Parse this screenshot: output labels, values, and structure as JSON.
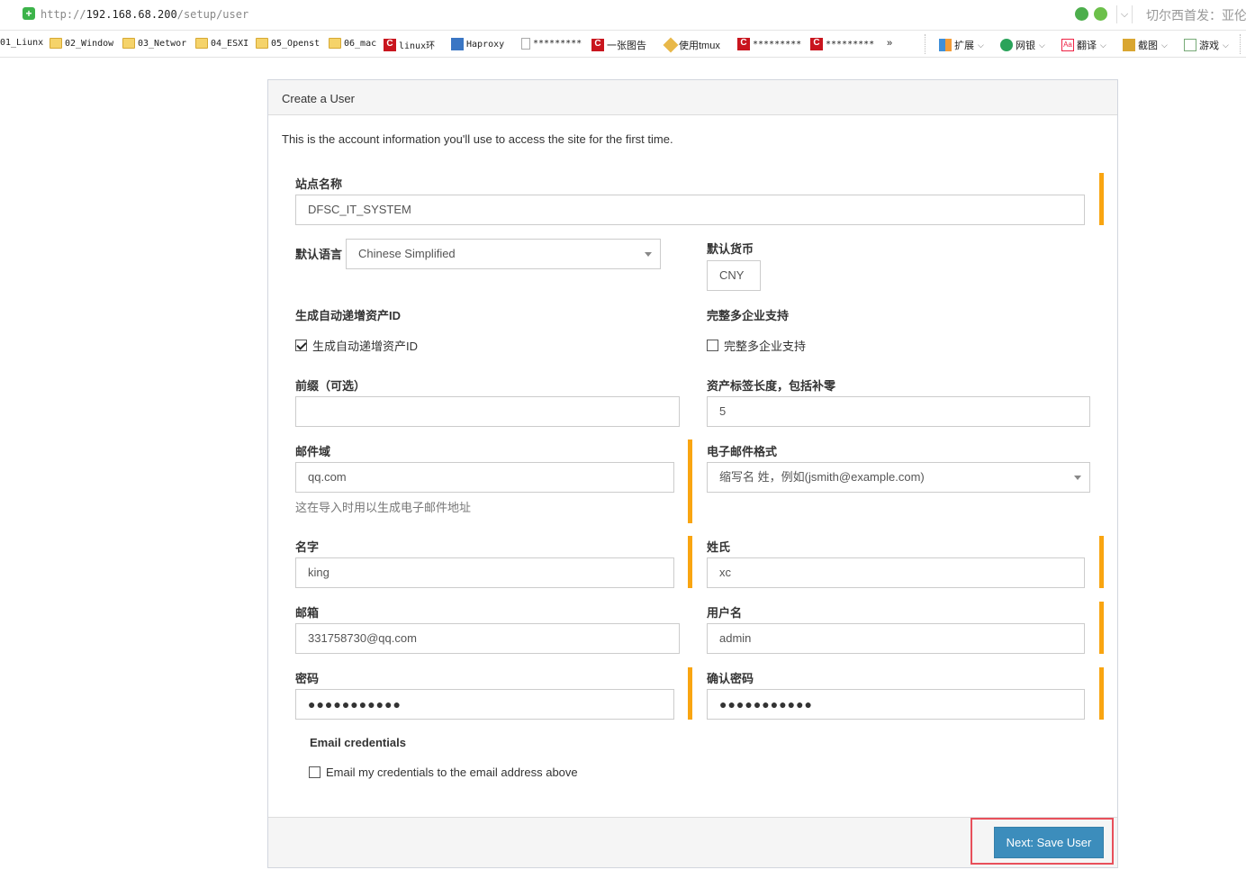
{
  "browser": {
    "url_scheme": "http://",
    "url_host": "192.168.68.200",
    "url_path": "/setup/user",
    "news_text": "切尔西首发：亚伦",
    "bookmarks": [
      {
        "label": "01_Liunx",
        "icon": "folder-icon"
      },
      {
        "label": "02_Window",
        "icon": "folder-icon"
      },
      {
        "label": "03_Networ",
        "icon": "folder-icon"
      },
      {
        "label": "04_ESXI",
        "icon": "folder-icon"
      },
      {
        "label": "05_Openst",
        "icon": "folder-icon"
      },
      {
        "label": "06_mac",
        "icon": "folder-icon"
      },
      {
        "label": "linux环",
        "icon": "csdn-icon"
      },
      {
        "label": "Haproxy",
        "icon": "haproxy-icon"
      },
      {
        "label": "*********",
        "icon": "page-icon"
      },
      {
        "label": "一张图告",
        "icon": "csdn-icon"
      },
      {
        "label": "使用tmux",
        "icon": "pen-icon"
      },
      {
        "label": "*********",
        "icon": "csdn-icon"
      },
      {
        "label": "*********",
        "icon": "csdn-icon"
      },
      {
        "label": "»",
        "icon": "chevron-right-icon"
      }
    ],
    "tools": [
      {
        "label": "扩展",
        "icon": "extension-icon"
      },
      {
        "label": "网银",
        "icon": "bank-icon"
      },
      {
        "label": "翻译",
        "icon": "translate-icon"
      },
      {
        "label": "截图",
        "icon": "screenshot-icon"
      },
      {
        "label": "游戏",
        "icon": "game-icon"
      }
    ],
    "csdn_glyph": "C",
    "translate_glyph": "Aa",
    "shield_glyph": "+"
  },
  "panel": {
    "title": "Create a User",
    "intro": "This is the account information you'll use to access the site for the first time."
  },
  "form": {
    "site_name": {
      "label": "站点名称",
      "value": "DFSC_IT_SYSTEM"
    },
    "default_language": {
      "label": "默认语言",
      "value": "Chinese Simplified"
    },
    "default_currency": {
      "label": "默认货币",
      "value": "CNY"
    },
    "auto_increment": {
      "label": "生成自动递增资产ID",
      "checkbox_label": "生成自动递增资产ID",
      "checked": true
    },
    "full_multi_company": {
      "label": "完整多企业支持",
      "checkbox_label": "完整多企业支持",
      "checked": false
    },
    "prefix": {
      "label": "前缀（可选）",
      "value": ""
    },
    "asset_tag_length": {
      "label": "资产标签长度，包括补零",
      "value": "5"
    },
    "email_domain": {
      "label": "邮件域",
      "value": "qq.com",
      "help": "这在导入时用以生成电子邮件地址"
    },
    "email_format": {
      "label": "电子邮件格式",
      "value": "缩写名 姓，例如(jsmith@example.com)"
    },
    "first_name": {
      "label": "名字",
      "value": "king"
    },
    "last_name": {
      "label": "姓氏",
      "value": "xc"
    },
    "email": {
      "label": "邮箱",
      "value": "331758730@qq.com"
    },
    "username": {
      "label": "用户名",
      "value": "admin"
    },
    "password": {
      "label": "密码",
      "value": "●●●●●●●●●●●"
    },
    "password_confirm": {
      "label": "确认密码",
      "value": "●●●●●●●●●●●"
    },
    "email_credentials": {
      "label": "Email credentials",
      "checkbox_label": "Email my credentials to the email address above",
      "checked": false
    }
  },
  "footer": {
    "submit_label": "Next: Save User"
  },
  "colors": {
    "required_bar": "#f9a511",
    "primary_button": "#3c8dbc",
    "focus_frame": "#e8505b"
  }
}
